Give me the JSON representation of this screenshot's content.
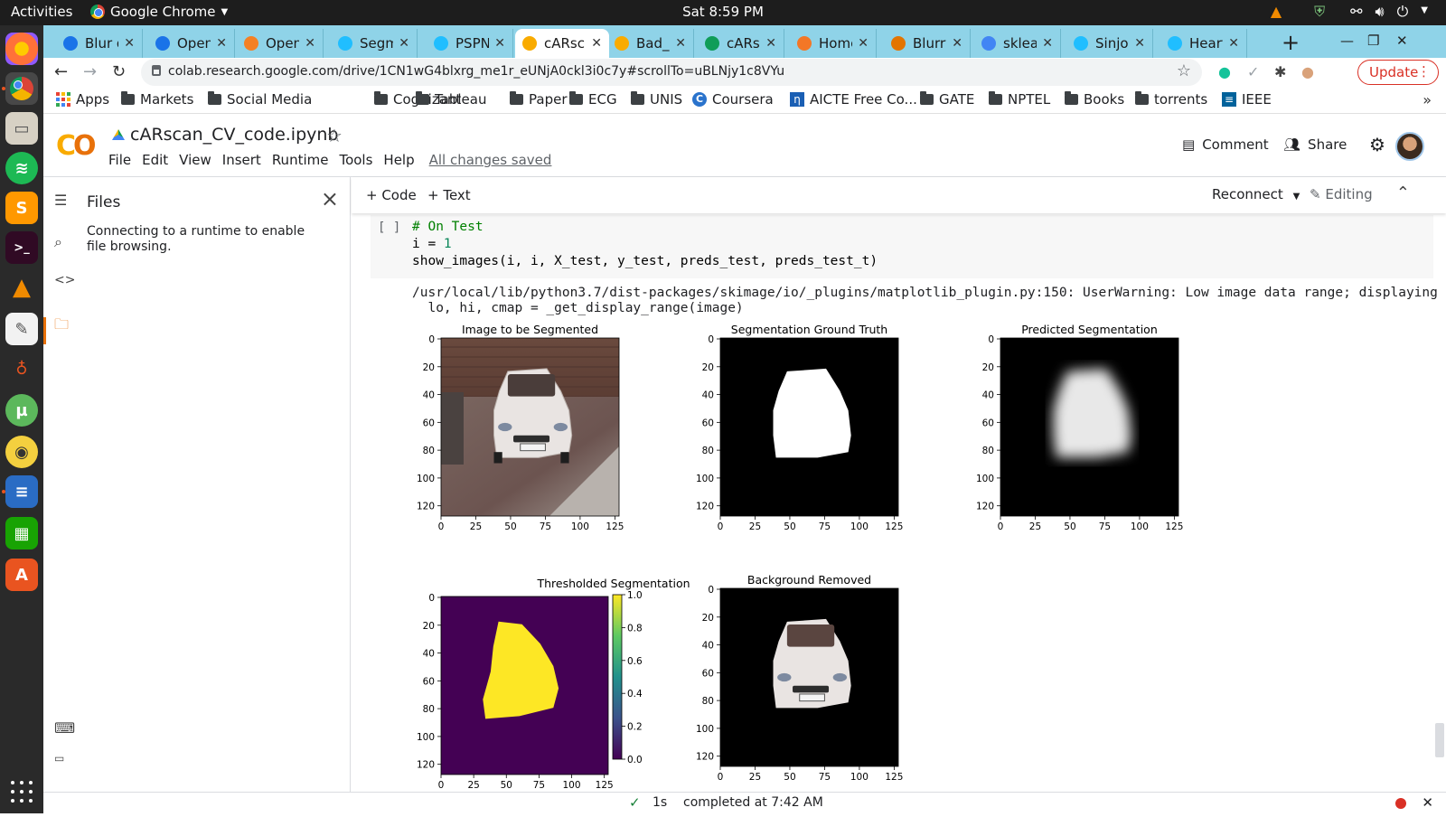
{
  "system": {
    "activities": "Activities",
    "app_name": "Google Chrome",
    "clock": "Sat  8:59 PM"
  },
  "tabs": [
    {
      "label": "Blur d",
      "favicon": "pixelied-icon",
      "color": "#1a73e8"
    },
    {
      "label": "Open",
      "favicon": "pixelied-icon",
      "color": "#1a73e8"
    },
    {
      "label": "Open",
      "favicon": "stackoverflow-icon",
      "color": "#f48024"
    },
    {
      "label": "Segm",
      "favicon": "kaggle-icon",
      "color": "#20beff"
    },
    {
      "label": "PSPN",
      "favicon": "kaggle-icon",
      "color": "#20beff"
    },
    {
      "label": "cARsc",
      "favicon": "colab-icon",
      "color": "#f9ab00",
      "active": true
    },
    {
      "label": "Bad_L",
      "favicon": "colab-icon",
      "color": "#f9ab00"
    },
    {
      "label": "cARsc",
      "favicon": "drive-icon",
      "color": "#0f9d58"
    },
    {
      "label": "Home",
      "favicon": "jupyter-icon",
      "color": "#f37726"
    },
    {
      "label": "Blurry",
      "favicon": "blogger-icon",
      "color": "#e37400"
    },
    {
      "label": "sklear",
      "favicon": "chart-icon",
      "color": "#4285f4"
    },
    {
      "label": "Sinjoy",
      "favicon": "kaggle-icon",
      "color": "#20beff"
    },
    {
      "label": "Heart",
      "favicon": "kaggle-icon",
      "color": "#20beff"
    }
  ],
  "omnibox": {
    "url": "colab.research.google.com/drive/1CN1wG4blxrg_me1r_eUNjA0ckl3i0c7y#scrollTo=uBLNjy1c8VYu",
    "update_label": "Update"
  },
  "bookmarks": [
    "Apps",
    "Markets",
    "Social Media",
    "Cognizant",
    "Tableau",
    "Paper",
    "ECG",
    "UNIS",
    "Coursera",
    "AICTE Free Co...",
    "GATE",
    "NPTEL",
    "Books",
    "torrents",
    "IEEE"
  ],
  "colab": {
    "logo": "CO",
    "notebook_name": "cARscan_CV_code.ipynb",
    "menu": [
      "File",
      "Edit",
      "View",
      "Insert",
      "Runtime",
      "Tools",
      "Help"
    ],
    "save_status": "All changes saved",
    "comment_label": "Comment",
    "share_label": "Share",
    "add_code": "+ Code",
    "add_text": "+ Text",
    "reconnect": "Reconnect",
    "editing": "Editing"
  },
  "files_panel": {
    "title": "Files",
    "message": "Connecting to a runtime to enable file browsing."
  },
  "cell": {
    "run_indicator": "[ ]",
    "line1": "# On Test",
    "line2_var": "i = ",
    "line2_num": "1",
    "line3": "show_images(i, i, X_test, y_test, preds_test, preds_test_t)",
    "warning_line1": "/usr/local/lib/python3.7/dist-packages/skimage/io/_plugins/matplotlib_plugin.py:150: UserWarning: Low image data range; displaying ima",
    "warning_line2": "  lo, hi, cmap = _get_display_range(image)"
  },
  "figures": [
    {
      "title": "Image to be Segmented",
      "kind": "photo"
    },
    {
      "title": "Segmentation Ground Truth",
      "kind": "mask"
    },
    {
      "title": "Predicted Segmentation",
      "kind": "prediction"
    },
    {
      "title": "Thresholded Segmentation",
      "kind": "threshold"
    },
    {
      "title": "Background Removed",
      "kind": "cutout"
    }
  ],
  "axis_ticks": {
    "x": [
      "0",
      "25",
      "50",
      "75",
      "100",
      "125"
    ],
    "y": [
      "0",
      "20",
      "40",
      "60",
      "80",
      "100",
      "120"
    ],
    "colorbar": [
      "1.0",
      "0.8",
      "0.6",
      "0.4",
      "0.2",
      "0.0"
    ]
  },
  "status": {
    "duration": "1s",
    "completed": "completed at 7:42 AM"
  },
  "colors": {
    "colab_orange": "#f9ab00",
    "viridis_purple": "#440154",
    "viridis_yellow": "#fde725",
    "update_red": "#d93025"
  }
}
